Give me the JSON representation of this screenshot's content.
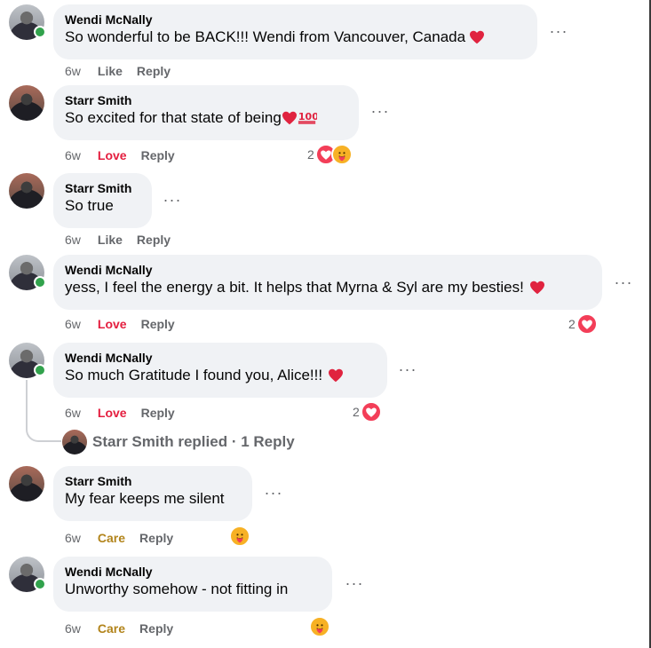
{
  "comments": [
    {
      "author": "Wendi McNally",
      "text": "So wonderful to be BACK!!! Wendi from Vancouver, Canada",
      "time": "6w",
      "reaction_action": "Like",
      "reply": "Reply",
      "reaction_count": ""
    },
    {
      "author": "Starr Smith",
      "text": "So excited for that state of being",
      "time": "6w",
      "reaction_action": "Love",
      "reply": "Reply",
      "reaction_count": "2"
    },
    {
      "author": "Starr Smith",
      "text": "So true",
      "time": "6w",
      "reaction_action": "Like",
      "reply": "Reply",
      "reaction_count": ""
    },
    {
      "author": "Wendi McNally",
      "text": "yess, I feel the energy a bit. It helps that Myrna & Syl are my besties!",
      "time": "6w",
      "reaction_action": "Love",
      "reply": "Reply",
      "reaction_count": "2"
    },
    {
      "author": "Wendi McNally",
      "text": "So much Gratitude I found you, Alice!!!",
      "time": "6w",
      "reaction_action": "Love",
      "reply": "Reply",
      "reaction_count": "2"
    },
    {
      "author": "Starr Smith",
      "text": "My fear keeps me silent",
      "time": "6w",
      "reaction_action": "Care",
      "reply": "Reply",
      "reaction_count": ""
    },
    {
      "author": "Wendi McNally",
      "text": "Unworthy somehow - not fitting in",
      "time": "6w",
      "reaction_action": "Care",
      "reply": "Reply",
      "reaction_count": ""
    }
  ],
  "replies_link": "Starr Smith replied · 1 Reply",
  "more_glyph": "···",
  "colors": {
    "bubble": "#f0f2f5",
    "muted_text": "#65676b",
    "love": "#e41e3f",
    "care": "#b2841b",
    "online": "#31a24c"
  },
  "icons": [
    "red-heart-icon",
    "hundred-points-icon",
    "love-reaction-icon",
    "care-reaction-icon",
    "online-status-icon",
    "more-options-icon"
  ]
}
